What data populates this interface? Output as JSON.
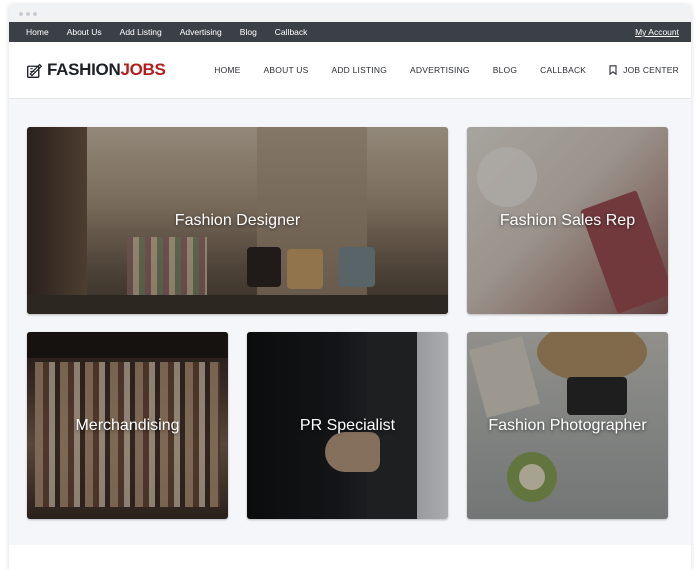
{
  "topbar": {
    "links": [
      "Home",
      "About Us",
      "Add Listing",
      "Advertising",
      "Blog",
      "Callback"
    ],
    "account": "My Account"
  },
  "header": {
    "logo_part1": "FASHION",
    "logo_part2": "JOBS",
    "nav": [
      "HOME",
      "ABOUT US",
      "ADD LISTING",
      "ADVERTISING",
      "BLOG",
      "CALLBACK"
    ],
    "job_center": "JOB CENTER"
  },
  "tiles": [
    {
      "label": "Fashion Designer"
    },
    {
      "label": "Fashion Sales Rep"
    },
    {
      "label": "Merchandising"
    },
    {
      "label": "PR Specialist"
    },
    {
      "label": "Fashion Photographer"
    }
  ],
  "colors": {
    "topbar_bg": "#3b4047",
    "brand_red": "#b1201c",
    "page_bg": "#f4f6f9"
  }
}
